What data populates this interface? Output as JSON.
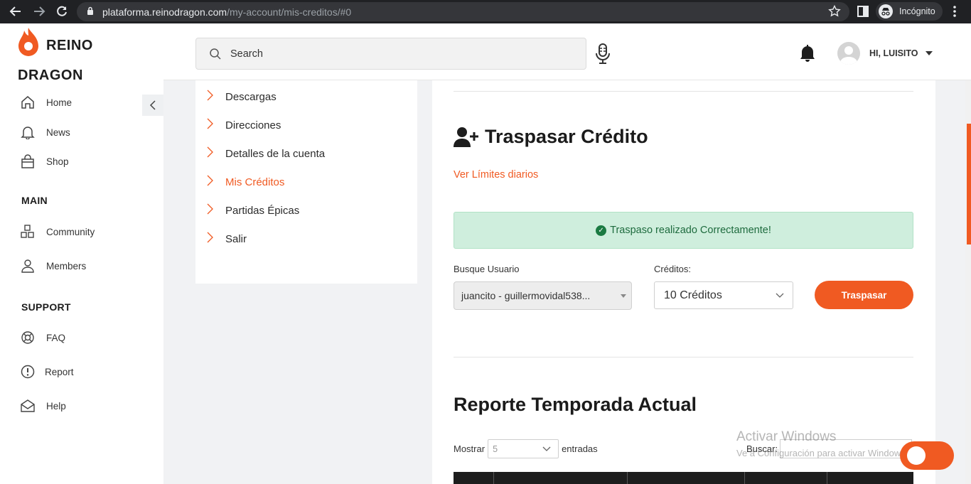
{
  "browser": {
    "url_host": "plataforma.reinodragon.com",
    "url_path": "/my-account/mis-creditos/#0",
    "incognito_label": "Incógnito"
  },
  "brand": {
    "line1": "REINO",
    "line2": "DRAGON",
    "accent": "#f05a22"
  },
  "sidebar": {
    "items": [
      {
        "label": "Home",
        "icon": "home-icon"
      },
      {
        "label": "News",
        "icon": "bell-icon"
      },
      {
        "label": "Shop",
        "icon": "shop-icon"
      }
    ],
    "main_title": "MAIN",
    "main_items": [
      {
        "label": "Community",
        "icon": "community-icon"
      },
      {
        "label": "Members",
        "icon": "members-icon"
      }
    ],
    "support_title": "SUPPORT",
    "support_items": [
      {
        "label": "FAQ",
        "icon": "faq-icon"
      },
      {
        "label": "Report",
        "icon": "report-icon"
      },
      {
        "label": "Help",
        "icon": "help-icon"
      }
    ]
  },
  "header": {
    "search_placeholder": "Search",
    "user_greeting": "HI, LUISITO"
  },
  "account_menu": {
    "items": [
      {
        "label": "Descargas"
      },
      {
        "label": "Direcciones"
      },
      {
        "label": "Detalles de la cuenta"
      },
      {
        "label": "Mis Créditos",
        "active": true
      },
      {
        "label": "Partidas Épicas"
      },
      {
        "label": "Salir"
      }
    ]
  },
  "transfer": {
    "title": "Traspasar Crédito",
    "limits_link": "Ver Límites diarios",
    "success_message": "Traspaso realizado Correctamente!",
    "user_label": "Busque Usuario",
    "user_value": "juancito - guillermovidal538...",
    "credits_label": "Créditos:",
    "credits_value": "10 Créditos",
    "submit_label": "Traspasar"
  },
  "report": {
    "title": "Reporte Temporada Actual",
    "show_label": "Mostrar",
    "show_value": "5",
    "entries_label": "entradas",
    "search_label": "Buscar:"
  },
  "watermark": {
    "line1": "Activar Windows",
    "line2": "Ve a Configuración para activar Windows."
  }
}
